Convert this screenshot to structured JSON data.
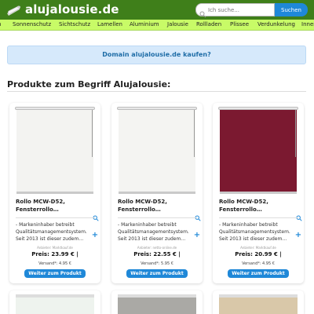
{
  "site": {
    "name": "alujalousie.de",
    "logo_icon": "curled-blind-logo-icon"
  },
  "search": {
    "placeholder": "Ich suche...",
    "button": "Suchen",
    "icon": "search-icon"
  },
  "nav": {
    "items": [
      "n",
      "Sonnenschutz",
      "Sichtschutz",
      "Lamellen",
      "Aluminium",
      "Jalousie",
      "Rollladen",
      "Plissee",
      "Verdunkelung",
      "Inner"
    ]
  },
  "domain_banner": "Domain alujalousie.de kaufen?",
  "section_title": "Produkte zum Begriff Alujalousie:",
  "products": [
    {
      "title_line1": "Rollo MCW-D52,",
      "title_line2": "Fensterrollo…",
      "description": "- Markeninhaber betreibt Qualitätsmanagementsystem. Seit 2013 ist dieser zudem…",
      "seller": "Anbieter: Markt​kauf.de",
      "price": "Preis: 23.99 € |",
      "shipping": "Versand*: 4.95 €",
      "button": "Weiter zum Produkt",
      "image_color": "#f3f3f1"
    },
    {
      "title_line1": "Rollo MCW-D52,",
      "title_line2": "Fensterrollo…",
      "description": "- Markeninhaber betreibt Qualitätsmanagementsystem. Seit 2013 ist dieser zudem…",
      "seller": "Anbieter: netto-online.de",
      "price": "Preis: 22.55 € |",
      "shipping": "Versand*: 5.95 €",
      "button": "Weiter zum Produkt",
      "image_color": "#f4f4f2"
    },
    {
      "title_line1": "Rollo MCW-D52,",
      "title_line2": "Fensterrollo…",
      "description": "- Markeninhaber betreibt Qualitätsmanagementsystem. Seit 2013 ist dieser zudem…",
      "seller": "Anbieter: Markt​kauf.de",
      "price": "Preis: 20.99 € |",
      "shipping": "Versand*: 4.95 €",
      "button": "Weiter zum Produkt",
      "image_color": "#7b1930"
    }
  ],
  "partial_products": [
    {
      "image_color": "#eef3ee"
    },
    {
      "image_color": "#aaa9a5"
    },
    {
      "image_color": "#d9c8a9"
    }
  ],
  "colors": {
    "header": "#3f7f1a",
    "nav": "#c8fb67",
    "accent": "#1f88d8",
    "banner": "#d6e9fb"
  },
  "icons": {
    "zoom": "zoom-icon",
    "expand": "plus-icon"
  },
  "labels": {
    "plus": "+"
  }
}
